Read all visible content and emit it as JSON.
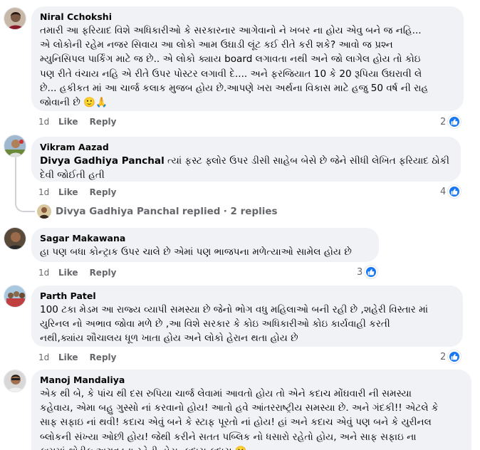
{
  "comments": [
    {
      "author": "Niral Cchokshi",
      "text": "તમારી આ ફરિયાદ વિશે અધિકારીઓ કે સરકારનાર આગેવાનો ને ખબર ના હોય એવુ બને જ નહિ...\nએ લોકોની રહેમ નજર સિવાય આ લોકો આમ ઉઘાડી લૂંટ કઈ રીતે કરી શકે? આવો જ પ્રશ્ન\nમ્યુનિસિપલ પાર્કિંગ માટે જ છે.. એ લોકો ક્યાય board લગાવતા નથી અને જો લાગેલ હોય તો કોઇ\nપણ રીતે વંચાય નહિ એ રીતે ઉપર પોસ્ટર લગાવી દે.... અને ફરજિયાત 10 કે 20 રૂપિયા ઉઘરાવી લે\nછે... હકીકત માં આ ચાર્જ કલાક મુજબ હોય છે.આપણે ખરા અર્થના વિકાસ માટે હજુ 50 વર્ષ ની રાહ\nજોવાની છે 🙂🙏",
      "time": "1d",
      "like": "Like",
      "reply": "Reply",
      "reactions": "2"
    },
    {
      "author": "Vikram Aazad",
      "mention": "Divya Gadhiya Panchal",
      "text": " ત્યાં ફસ્ટ ફ્લોર ઉપર ડીસી સાહેબ બેસે છે જેને સીધી લેખિત ફરિયાદ ઠોકી\nદેવી જોઈતી હતી",
      "time": "1d",
      "like": "Like",
      "reply": "Reply",
      "reactions": "4"
    },
    {
      "author": "Sagar Makawana",
      "text": "હા પણ બધા કોન્ટ્રાક ઉપર ચાલે છે એમાં પણ ભાજપના મળેત્યાઓ સામેલ હોય છે",
      "time": "1d",
      "like": "Like",
      "reply": "Reply",
      "reactions": "3"
    },
    {
      "author": "Parth Patel",
      "text": "100 ટકા મેડમ આ રાજ્ય વ્યાપી સમસ્યા છે જેનો ભોગ વધુ મહિલાઓ બની રહી છે ,શહેરી વિસ્તાર માં\nયુરિનલ નો અભાવ જોવા મળે છે ,આ વિશે સરકાર કે કોઇ અધિકારીઓ કોઇ કાર્યવાહી કરતી\nનથી,ક્યાંય શૌચાલય ધૂળ ખાતા હોય અને લોકો હેરાન થતા હોય છે",
      "time": "1d",
      "like": "Like",
      "reply": "Reply",
      "reactions": "2"
    },
    {
      "author": "Manoj Mandaliya",
      "text": "એક થી બે, કે પાંચ થી દસ રુપિયા ચાર્જ લેવામાં આવતો હોય તો એને કદાચ મોંઘવારી ની સમસ્યા\nકહેવાય, એમા બહુ ગુસ્સો નાં કરવાનો હોય! આતો હવે આંતરરાષ્ટ્રીય સમસ્યા છે. અને ગંદકી!! એટલે કે\nસાફ સફાઇ નાં થવી! કદાચ એવું બને કે સ્ટાફ પૂરતો નાં હોય! હાં અને કદાચ એવું પણ બને કે યુરીનલ\nબ્લોકની સંખ્યા ઓછી હોય! જેથી કરીને સતત પબ્લિક નો ધસારો રહેતો હોય, અને સાફ સફાઇ ના\nકામમાં થોડીક અગવડતા રહેતી હોય. કદાચ કદાચ 🙂"
    }
  ],
  "reply_summary": {
    "name": "Divya Gadhiya Panchal",
    "label": "replied",
    "count": "· 2 replies"
  },
  "colors": {
    "bubble": "#f0f2f5",
    "meta": "#65676b",
    "like_blue": "#1877f2"
  }
}
